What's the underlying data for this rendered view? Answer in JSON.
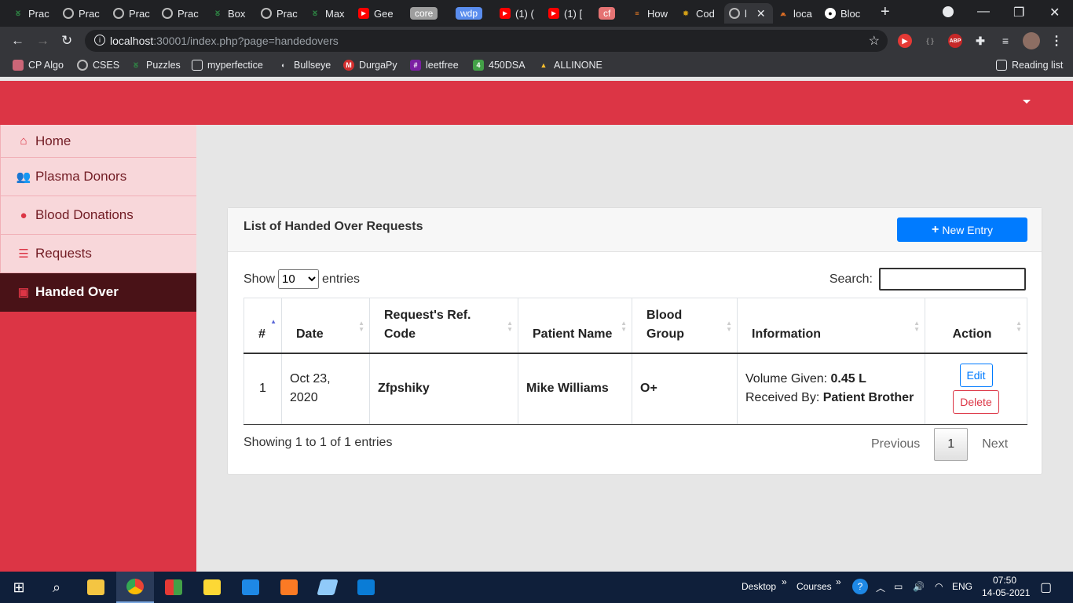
{
  "browser": {
    "tabs": [
      {
        "label": "Prac",
        "icon": "gfg-icon"
      },
      {
        "label": "Prac",
        "icon": "globe-icon"
      },
      {
        "label": "Prac",
        "icon": "globe-icon"
      },
      {
        "label": "Prac",
        "icon": "globe-icon"
      },
      {
        "label": "Box",
        "icon": "gfg-icon"
      },
      {
        "label": "Prac",
        "icon": "globe-icon"
      },
      {
        "label": "Max",
        "icon": "gfg-icon"
      },
      {
        "label": "Gee",
        "icon": "youtube-icon"
      },
      {
        "label": "core",
        "icon": "chip"
      },
      {
        "label": "wdp",
        "icon": "chip"
      },
      {
        "label": "(1) (",
        "icon": "youtube-icon"
      },
      {
        "label": "(1) [",
        "icon": "youtube-icon"
      },
      {
        "label": "cf",
        "icon": "chip"
      },
      {
        "label": "How",
        "icon": "stackoverflow-icon"
      },
      {
        "label": "Cod",
        "icon": "codechef-icon"
      },
      {
        "label": "l",
        "icon": "globe-icon"
      },
      {
        "label": "loca",
        "icon": "xampp-icon"
      },
      {
        "label": "Bloc",
        "icon": "github-icon"
      }
    ],
    "url_host": "localhost",
    "url_rest": ":30001/index.php?page=handedovers",
    "bookmarks": [
      "CP Algo",
      "CSES",
      "Puzzles",
      "myperfectice",
      "Bullseye",
      "DurgaPy",
      "leetfree",
      "450DSA",
      "ALLINONE"
    ],
    "reading_list": "Reading list"
  },
  "sidebar": {
    "items": [
      {
        "label": "Home",
        "icon": "home-icon"
      },
      {
        "label": "Plasma Donors",
        "icon": "users-icon"
      },
      {
        "label": "Blood Donations",
        "icon": "blood-drop-icon"
      },
      {
        "label": "Requests",
        "icon": "list-icon"
      },
      {
        "label": "Handed Over",
        "icon": "toolbox-icon"
      }
    ]
  },
  "card": {
    "title": "List of Handed Over Requests",
    "new_entry": "New Entry",
    "show_label": "Show",
    "show_value": "10",
    "entries_label": "entries",
    "search_label": "Search:"
  },
  "table": {
    "headers": [
      "#",
      "Date",
      "Request's Ref. Code",
      "Patient Name",
      "Blood Group",
      "Information",
      "Action"
    ],
    "rows": [
      {
        "num": "1",
        "date": "Oct 23, 2020",
        "ref": "Zfpshiky",
        "patient": "Mike Williams",
        "blood": "O+",
        "volume_label": "Volume Given:",
        "volume_value": "0.45 L",
        "received_label": "Received By:",
        "received_value": "Patient Brother",
        "edit": "Edit",
        "delete": "Delete"
      }
    ]
  },
  "pagination": {
    "info": "Showing 1 to 1 of 1 entries",
    "previous": "Previous",
    "current": "1",
    "next": "Next"
  },
  "taskbar": {
    "desktop": "Desktop",
    "courses": "Courses",
    "lang": "ENG",
    "time": "07:50",
    "date": "14-05-2021"
  },
  "colors": {
    "brand_red": "#dc3545",
    "sidebar_active": "#491217",
    "primary_blue": "#007bff"
  }
}
